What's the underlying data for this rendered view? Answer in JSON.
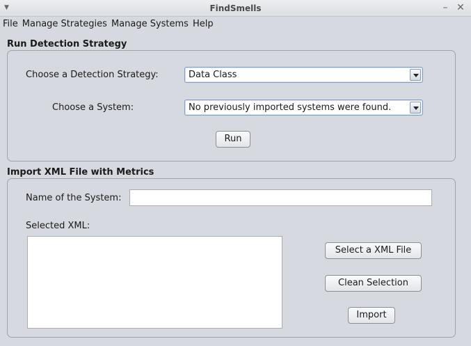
{
  "window": {
    "title": "FindSmells",
    "menu_icon": "down-triangle-icon",
    "minimize_glyph": "–",
    "close_glyph": "✕"
  },
  "menubar": {
    "items": [
      "File",
      "Manage Strategies",
      "Manage Systems",
      "Help"
    ]
  },
  "run_section": {
    "title": "Run Detection Strategy",
    "strategy_label": "Choose a Detection Strategy:",
    "strategy_selected": "Data Class",
    "system_label": "Choose a System:",
    "system_selected": "No previously imported systems were found.",
    "run_button": "Run"
  },
  "import_section": {
    "title": "Import XML File with Metrics",
    "name_label": "Name of the System:",
    "name_value": "",
    "selected_xml_label": "Selected XML:",
    "selected_xml_items": [],
    "select_button": "Select a XML File",
    "clean_button": "Clean Selection",
    "import_button": "Import"
  }
}
